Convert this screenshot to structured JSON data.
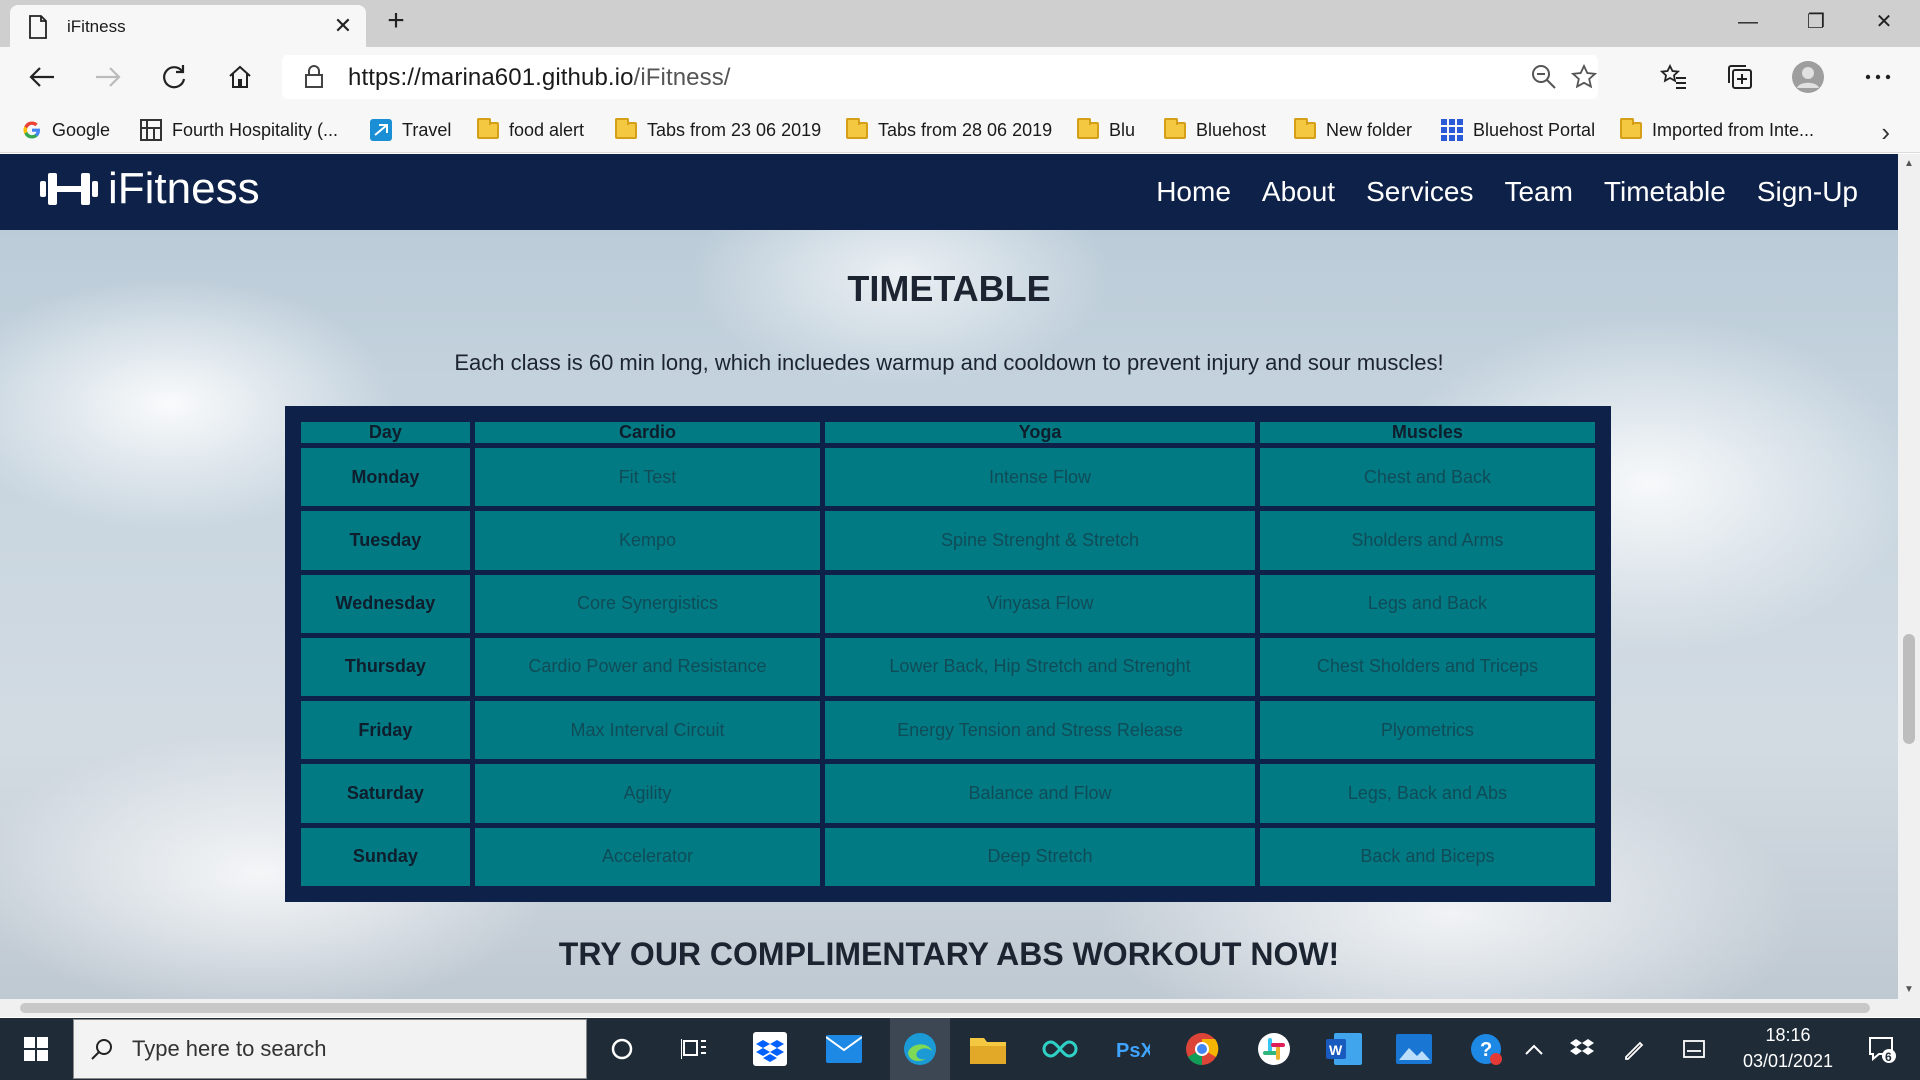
{
  "browser": {
    "tab_title": "iFitness",
    "url_host": "https://marina601.github.io",
    "url_path": "/iFitness/"
  },
  "bookmarks": [
    {
      "label": "Google",
      "icon": "google-icon"
    },
    {
      "label": "Fourth Hospitality (...",
      "icon": "grid-app-icon"
    },
    {
      "label": "Travel",
      "icon": "travel-icon"
    },
    {
      "label": "food alert",
      "icon": "folder-icon"
    },
    {
      "label": "Tabs from 23 06 2019",
      "icon": "folder-icon"
    },
    {
      "label": "Tabs from 28 06 2019",
      "icon": "folder-icon"
    },
    {
      "label": "Blu",
      "icon": "folder-icon"
    },
    {
      "label": "Bluehost",
      "icon": "folder-icon"
    },
    {
      "label": "New folder",
      "icon": "folder-icon"
    },
    {
      "label": "Bluehost Portal",
      "icon": "bluehost-grid-icon"
    },
    {
      "label": "Imported from Inte...",
      "icon": "folder-icon"
    }
  ],
  "site": {
    "logo_text": "iFitness",
    "nav": [
      "Home",
      "About",
      "Services",
      "Team",
      "Timetable",
      "Sign-Up"
    ],
    "timetable_title": "TIMETABLE",
    "timetable_desc": "Each class is 60 min long, which incluedes warmup and cooldown to prevent injury and sour muscles!",
    "table": {
      "headers": [
        "Day",
        "Cardio",
        "Yoga",
        "Muscles"
      ],
      "rows": [
        [
          "Monday",
          "Fit Test",
          "Intense Flow",
          "Chest and Back"
        ],
        [
          "Tuesday",
          "Kempo",
          "Spine Strenght & Stretch",
          "Sholders and Arms"
        ],
        [
          "Wednesday",
          "Core Synergistics",
          "Vinyasa Flow",
          "Legs and Back"
        ],
        [
          "Thursday",
          "Cardio Power and Resistance",
          "Lower Back, Hip Stretch and Strenght",
          "Chest Sholders and Triceps"
        ],
        [
          "Friday",
          "Max Interval Circuit",
          "Energy Tension and Stress Release",
          "Plyometrics"
        ],
        [
          "Saturday",
          "Agility",
          "Balance and Flow",
          "Legs, Back and Abs"
        ],
        [
          "Sunday",
          "Accelerator",
          "Deep Stretch",
          "Back and Biceps"
        ]
      ]
    },
    "promo_title": "TRY OUR COMPLIMENTARY ABS WORKOUT NOW!"
  },
  "taskbar": {
    "search_placeholder": "Type here to search",
    "time": "18:16",
    "date": "03/01/2021",
    "notification_count": "6"
  },
  "colors": {
    "nav_bg": "#0e2149",
    "cell_bg": "#027a84"
  }
}
